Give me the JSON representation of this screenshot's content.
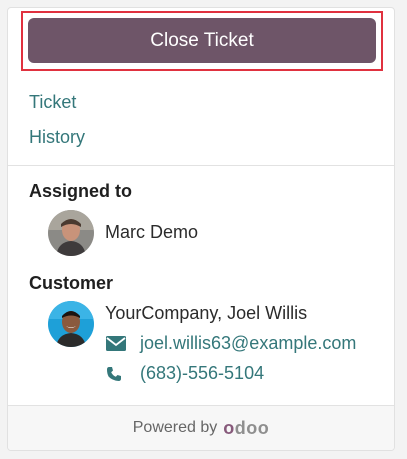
{
  "actions": {
    "close_ticket_label": "Close Ticket"
  },
  "nav": {
    "ticket_label": "Ticket",
    "history_label": "History"
  },
  "assigned": {
    "heading": "Assigned to",
    "name": "Marc Demo"
  },
  "customer": {
    "heading": "Customer",
    "name": "YourCompany, Joel Willis",
    "email": "joel.willis63@example.com",
    "phone": "(683)-556-5104"
  },
  "footer": {
    "powered_by": "Powered by",
    "brand": "odoo"
  },
  "icons": {
    "email": "envelope-icon",
    "phone": "phone-icon"
  },
  "colors": {
    "primary_button": "#6e5568",
    "link": "#34777a",
    "highlight": "#e0313f",
    "brand_purple": "#875a7b",
    "brand_gray": "#8f8f8f"
  }
}
